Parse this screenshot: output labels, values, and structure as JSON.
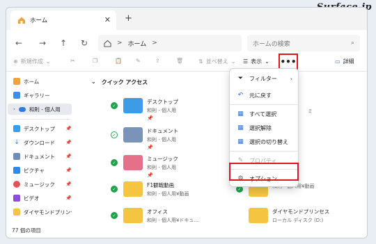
{
  "watermark": "_Surface.jp",
  "tab": {
    "title": "ホーム",
    "close": "✕",
    "new_tab": "+"
  },
  "address": {
    "path_home": "ホーム",
    "sep": ">",
    "search_placeholder": "ホームの検索"
  },
  "toolbar": {
    "new": "新規作成",
    "sort": "並べ替え",
    "view": "表示",
    "more": "•••",
    "details": "詳細"
  },
  "sidebar": {
    "items": [
      {
        "label": "ホーム",
        "icon": "home-icon"
      },
      {
        "label": "ギャラリー",
        "icon": "gallery-icon"
      },
      {
        "label": "和則 - 個人用",
        "icon": "onedrive-icon"
      },
      {
        "label": "デスクトップ",
        "icon": "desktop-icon"
      },
      {
        "label": "ダウンロード",
        "icon": "download-icon"
      },
      {
        "label": "ドキュメント",
        "icon": "document-icon"
      },
      {
        "label": "ピクチャ",
        "icon": "picture-icon"
      },
      {
        "label": "ミュージック",
        "icon": "music-icon"
      },
      {
        "label": "ビデオ",
        "icon": "video-icon"
      },
      {
        "label": "ダイヤモンドプリンセ",
        "icon": "folder-icon"
      }
    ]
  },
  "content": {
    "section_title": "クイック アクセス",
    "folders": [
      {
        "name": "デスクトップ",
        "sub": "和則 - 個人用"
      },
      {
        "name": "ドキュメント",
        "sub": "和則 - 個人用"
      },
      {
        "name": "ミュージック",
        "sub": "和則 - 個人用"
      },
      {
        "name": "F1観戦動画",
        "sub": "和則 - 個人用¥動画"
      },
      {
        "name": "オフィス",
        "sub": "和則 - 個人用¥ドキュ..."
      },
      {
        "name": "",
        "sub": "和則 - 個人用¥動画"
      },
      {
        "name": "ダイヤモンドプリンセス",
        "sub": "ローカル ディスク (D:)"
      }
    ],
    "partial_right": "ミ"
  },
  "menu": {
    "items": [
      {
        "label": "フィルター",
        "icon": "filter-icon"
      },
      {
        "label": "元に戻す",
        "icon": "undo-icon"
      },
      {
        "label": "すべて選択",
        "icon": "select-all-icon"
      },
      {
        "label": "選択解除",
        "icon": "select-none-icon"
      },
      {
        "label": "選択の切り替え",
        "icon": "invert-selection-icon"
      },
      {
        "label": "プロパティ",
        "icon": "properties-icon"
      },
      {
        "label": "オプション",
        "icon": "gear-icon"
      }
    ]
  },
  "status": "77 個の項目",
  "colors": {
    "highlight": "#e0141e",
    "check": "#1ea34a",
    "folder": "#f5c542"
  }
}
